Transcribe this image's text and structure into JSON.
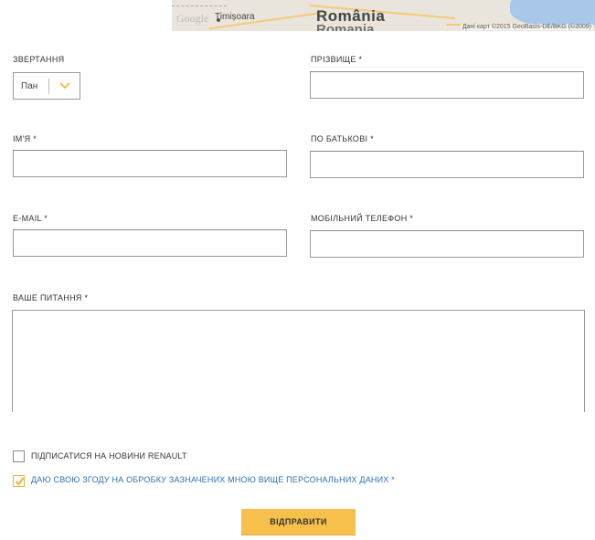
{
  "map": {
    "city": "Timișoara",
    "country": "România",
    "country_secondary": "Romania",
    "logo": "Google",
    "attribution": "Дані карт ©2015 GeoBasis-DE/BKG (©2009)"
  },
  "form": {
    "salutation": {
      "label": "ЗВЕРТАННЯ",
      "value": "Пан",
      "icon": "chevron-down-icon"
    },
    "surname": {
      "label": "ПРІЗВИЩЕ *",
      "value": ""
    },
    "first_name": {
      "label": "ІМ'Я *",
      "value": ""
    },
    "patronymic": {
      "label": "ПО БАТЬКОВІ *",
      "value": ""
    },
    "email": {
      "label": "E-MAIL *",
      "value": ""
    },
    "mobile": {
      "label": "МОБІЛЬНИЙ ТЕЛЕФОН *",
      "value": ""
    },
    "question": {
      "label": "ВАШЕ ПИТАННЯ *",
      "value": ""
    },
    "subscribe": {
      "label": "ПІДПИСАТИСЯ НА НОВИНИ RENAULT",
      "checked": false
    },
    "consent": {
      "label": "ДАЮ СВОЮ ЗГОДУ НА ОБРОБКУ ЗАЗНАЧЕНИХ МНОЮ ВИЩЕ ПЕРСОНАЛЬНИХ ДАНИХ *",
      "checked": true
    },
    "submit_label": "ВІДПРАВИТИ"
  },
  "colors": {
    "accent": "#f7c04a",
    "link": "#2e6fb0",
    "border": "#9a9a9a"
  }
}
